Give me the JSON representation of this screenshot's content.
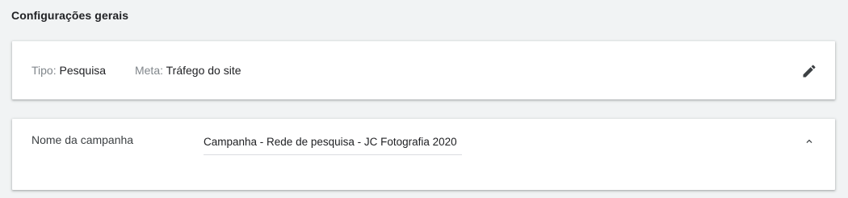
{
  "section": {
    "title": "Configurações gerais"
  },
  "summary": {
    "type_label": "Tipo:",
    "type_value": "Pesquisa",
    "goal_label": "Meta:",
    "goal_value": "Tráfego do site",
    "edit_icon": "pencil-icon"
  },
  "campaign_name": {
    "label": "Nome da campanha",
    "value": "Campanha - Rede de pesquisa - JC Fotografia 2020",
    "collapse_icon": "chevron-up-icon"
  },
  "colors": {
    "page_background": "#f1f3f4",
    "card_background": "#ffffff",
    "muted_text": "#80868b",
    "primary_text": "#202124",
    "icon": "#3c4043"
  }
}
